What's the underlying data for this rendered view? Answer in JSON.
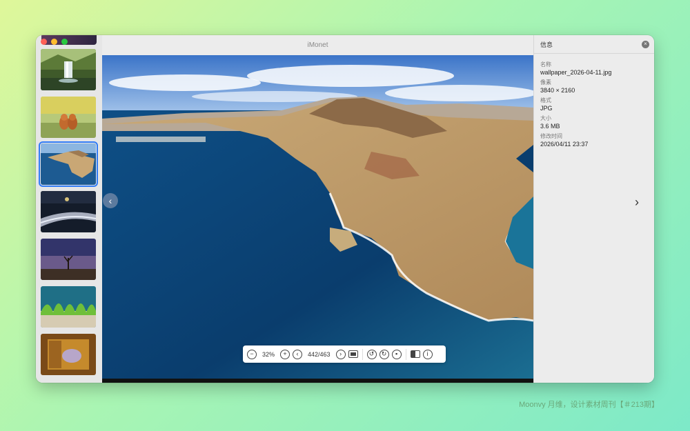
{
  "app": {
    "title": "iMonet"
  },
  "sidebar": {
    "thumbnails": [
      {
        "name": "waterfall"
      },
      {
        "name": "fox"
      },
      {
        "name": "island",
        "selected": true
      },
      {
        "name": "night-road"
      },
      {
        "name": "milky-way-tree"
      },
      {
        "name": "green-leaves"
      },
      {
        "name": "golden-art"
      }
    ]
  },
  "toolbar": {
    "zoom": "32%",
    "counter": "442/463"
  },
  "info_panel": {
    "title": "信息",
    "fields": [
      {
        "label": "名称",
        "value": "wallpaper_2026-04-11.jpg"
      },
      {
        "label": "像素",
        "value": "3840 × 2160"
      },
      {
        "label": "格式",
        "value": "JPG"
      },
      {
        "label": "大小",
        "value": "3.6 MB"
      },
      {
        "label": "修改时间",
        "value": "2026/04/11 23:37"
      }
    ]
  },
  "watermark": "Moonvy 月维，设计素材周刊【＃213期】",
  "icons": {
    "prev": "chevron-left-icon",
    "next": "chevron-right-icon",
    "close": "close-icon"
  }
}
